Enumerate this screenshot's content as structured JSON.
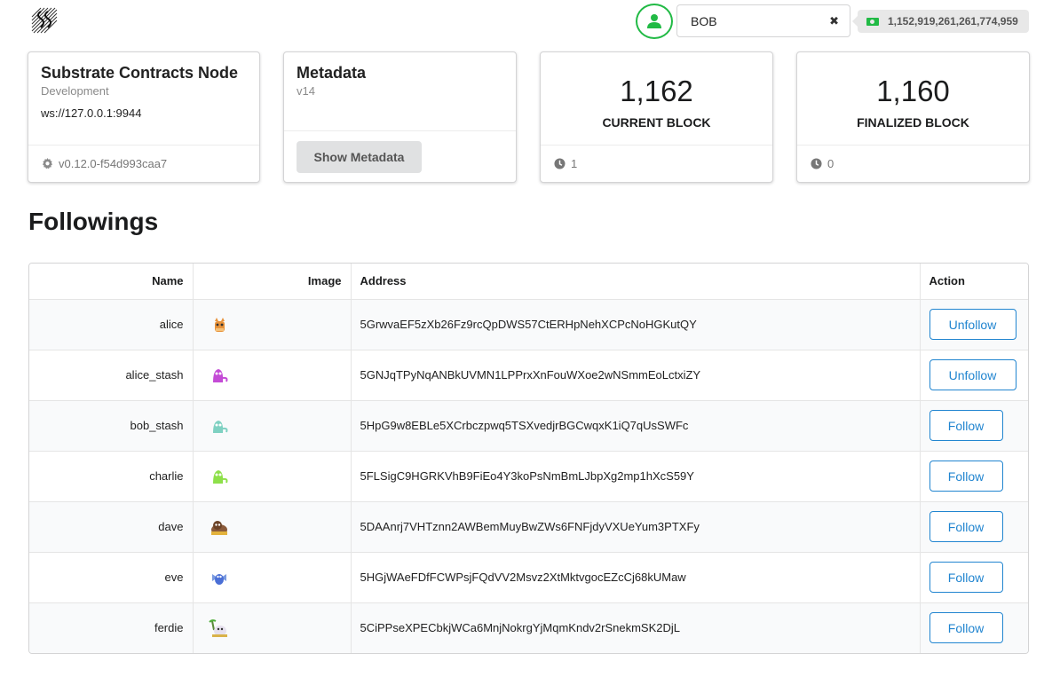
{
  "header": {
    "logo_icon": "substrate-logo-icon",
    "user_icon": "user-icon",
    "account_name": "BOB",
    "clear_icon": "clear-icon",
    "balance": "1,152,919,261,261,774,959",
    "balance_icon": "money-icon",
    "accent_green": "#21ba45"
  },
  "cards": {
    "node": {
      "title": "Substrate Contracts Node",
      "subtitle": "Development",
      "url": "ws://127.0.0.1:9944",
      "version": "v0.12.0-f54d993caa7",
      "version_icon": "gear-icon"
    },
    "metadata": {
      "title": "Metadata",
      "version": "v14",
      "button": "Show Metadata"
    },
    "current_block": {
      "value": "1,162",
      "label": "CURRENT BLOCK",
      "timer": "1",
      "timer_icon": "clock-icon"
    },
    "finalized_block": {
      "value": "1,160",
      "label": "FINALIZED BLOCK",
      "timer": "0",
      "timer_icon": "clock-icon"
    }
  },
  "followings": {
    "title": "Followings",
    "columns": {
      "name": "Name",
      "image": "Image",
      "address": "Address",
      "action": "Action"
    },
    "accent_blue": "#2185d0",
    "rows": [
      {
        "name": "alice",
        "avatar": "orange-cat-avatar",
        "address": "5GrwvaEF5zXb26Fz9rcQpDWS57CtERHpNehXCPcNoHGKutQY",
        "action": "Unfollow"
      },
      {
        "name": "alice_stash",
        "avatar": "purple-monster-avatar",
        "address": "5GNJqTPyNqANBkUVMN1LPPrxXnFouWXoe2wNSmmEoLctxiZY",
        "action": "Unfollow"
      },
      {
        "name": "bob_stash",
        "avatar": "teal-monster-avatar",
        "address": "5HpG9w8EBLe5XCrbczpwq5TSXvedjrBGCwqxK1iQ7qUsSWFc",
        "action": "Follow"
      },
      {
        "name": "charlie",
        "avatar": "green-monster-avatar",
        "address": "5FLSigC9HGRKVhB9FiEo4Y3koPsNmBmLJbpXg2mp1hXcS59Y",
        "action": "Follow"
      },
      {
        "name": "dave",
        "avatar": "brown-monster-avatar",
        "address": "5DAAnrj7VHTznn2AWBemMuyBwZWs6FNFjdyVXUeYum3PTXFy",
        "action": "Follow"
      },
      {
        "name": "eve",
        "avatar": "blue-dragon-avatar",
        "address": "5HGjWAeFDfFCWPsjFQdVV2Msvz2XtMktvgocEZcCj68kUMaw",
        "action": "Follow"
      },
      {
        "name": "ferdie",
        "avatar": "white-creature-avatar",
        "address": "5CiPPseXPECbkjWCa6MnjNokrgYjMqmKndv2rSnekmSK2DjL",
        "action": "Follow"
      }
    ]
  }
}
